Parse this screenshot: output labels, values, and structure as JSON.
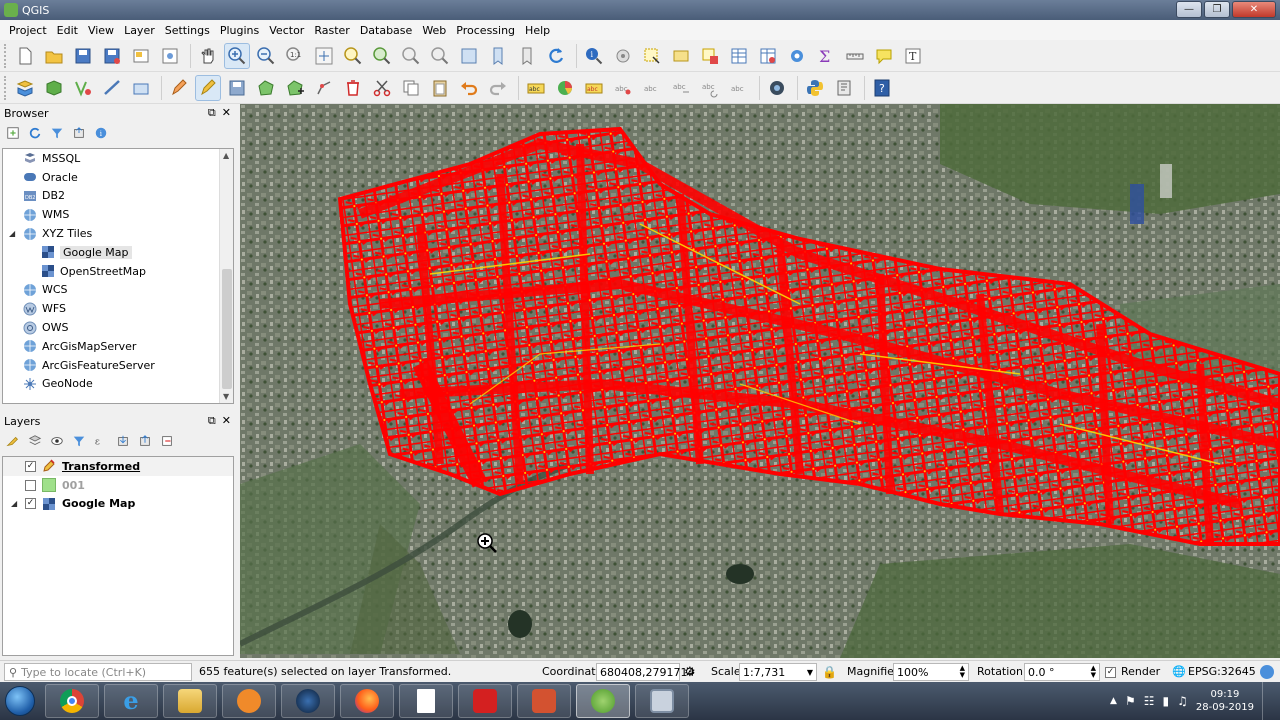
{
  "window": {
    "title": "QGIS"
  },
  "menubar": [
    "Project",
    "Edit",
    "View",
    "Layer",
    "Settings",
    "Plugins",
    "Vector",
    "Raster",
    "Database",
    "Web",
    "Processing",
    "Help"
  ],
  "browser": {
    "title": "Browser",
    "items": [
      {
        "label": "MSSQL",
        "icon": "mssql-icon"
      },
      {
        "label": "Oracle",
        "icon": "oracle-icon"
      },
      {
        "label": "DB2",
        "icon": "db2-icon"
      },
      {
        "label": "WMS",
        "icon": "wms-icon"
      },
      {
        "label": "XYZ Tiles",
        "icon": "xyz-tiles-icon"
      },
      {
        "label": "Google Map",
        "icon": "tile-icon"
      },
      {
        "label": "OpenStreetMap",
        "icon": "tile-icon"
      },
      {
        "label": "WCS",
        "icon": "wcs-icon"
      },
      {
        "label": "WFS",
        "icon": "wfs-icon"
      },
      {
        "label": "OWS",
        "icon": "ows-icon"
      },
      {
        "label": "ArcGisMapServer",
        "icon": "arcgis-icon"
      },
      {
        "label": "ArcGisFeatureServer",
        "icon": "arcgis-icon"
      },
      {
        "label": "GeoNode",
        "icon": "geonode-icon"
      }
    ]
  },
  "layers": {
    "title": "Layers",
    "items": [
      {
        "label": "Transformed",
        "checked": true
      },
      {
        "label": "001",
        "checked": false
      },
      {
        "label": "Google Map",
        "checked": true
      }
    ]
  },
  "status": {
    "locate_placeholder": "Type to locate (Ctrl+K)",
    "selection_message": "655 feature(s) selected on layer Transformed.",
    "coordinate_label": "Coordinate",
    "coordinate_value": "680408,2791714",
    "scale_label": "Scale",
    "scale_value": "1:7,731",
    "magnifier_label": "Magnifier",
    "magnifier_value": "100%",
    "rotation_label": "Rotation",
    "rotation_value": "0.0 °",
    "render_label": "Render",
    "crs_label": "EPSG:32645"
  },
  "taskbar": {
    "time": "09:19",
    "date": "28-09-2019"
  },
  "colors": {
    "selection_red": "#ff0000",
    "highlight_yellow": "#ffd700"
  }
}
